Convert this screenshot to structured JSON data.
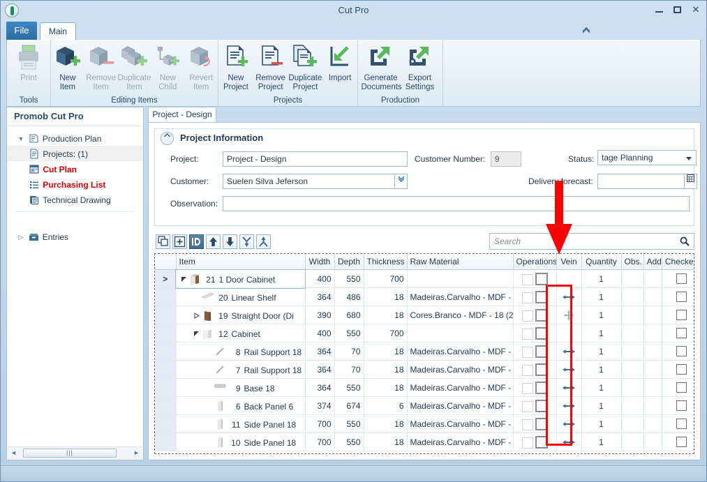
{
  "window": {
    "title": "Cut Pro",
    "minimize": "minimize-icon",
    "maximize": "maximize-icon",
    "close": "✕"
  },
  "ribbon": {
    "tabs": [
      {
        "label": "File",
        "id": "file"
      },
      {
        "label": "Main",
        "id": "main"
      }
    ],
    "groups": [
      {
        "label": "Tools",
        "items": [
          {
            "label_line1": "Print",
            "label_line2": "",
            "icon": "printer-icon",
            "enabled": false
          }
        ]
      },
      {
        "label": "Editing Items",
        "items": [
          {
            "label_line1": "New",
            "label_line2": "Item",
            "icon": "new-item-icon",
            "enabled": true
          },
          {
            "label_line1": "Remove",
            "label_line2": "Item",
            "icon": "remove-item-icon",
            "enabled": false
          },
          {
            "label_line1": "Duplicate",
            "label_line2": "Item",
            "icon": "duplicate-item-icon",
            "enabled": false
          },
          {
            "label_line1": "New",
            "label_line2": "Child",
            "icon": "new-child-icon",
            "enabled": false
          },
          {
            "label_line1": "Revert",
            "label_line2": "Item",
            "icon": "revert-item-icon",
            "enabled": false
          }
        ]
      },
      {
        "label": "Projects",
        "items": [
          {
            "label_line1": "New",
            "label_line2": "Project",
            "icon": "new-project-icon",
            "enabled": true
          },
          {
            "label_line1": "Remove",
            "label_line2": "Project",
            "icon": "remove-project-icon",
            "enabled": true
          },
          {
            "label_line1": "Duplicate",
            "label_line2": "Project",
            "icon": "duplicate-project-icon",
            "enabled": true
          },
          {
            "label_line1": "Import",
            "label_line2": "",
            "icon": "import-icon",
            "enabled": true
          }
        ]
      },
      {
        "label": "Production",
        "items": [
          {
            "label_line1": "Generate",
            "label_line2": "Documents",
            "icon": "generate-documents-icon",
            "enabled": true
          },
          {
            "label_line1": "Export",
            "label_line2": "Settings",
            "icon": "export-settings-icon",
            "enabled": true
          }
        ]
      }
    ],
    "collapse_icon": "chevron-up-icon"
  },
  "sidebar": {
    "title": "Promob Cut Pro",
    "items": [
      {
        "label": "Production Plan",
        "icon": "production-plan-icon",
        "level": 0,
        "expanded": true,
        "selected": false,
        "highlight": false
      },
      {
        "label": "Projects: (1)",
        "icon": "projects-icon",
        "level": 1,
        "expanded": null,
        "selected": true,
        "highlight": false
      },
      {
        "label": "Cut Plan",
        "icon": "cut-plan-icon",
        "level": 1,
        "expanded": null,
        "selected": false,
        "highlight": true
      },
      {
        "label": "Purchasing List",
        "icon": "purchasing-list-icon",
        "level": 1,
        "expanded": null,
        "selected": false,
        "highlight": true
      },
      {
        "label": "Technical Drawing",
        "icon": "technical-drawing-icon",
        "level": 1,
        "expanded": null,
        "selected": false,
        "highlight": false
      },
      {
        "label": "Entries",
        "icon": "entries-icon",
        "level": 0,
        "expanded": false,
        "selected": false,
        "highlight": false
      }
    ],
    "scrollbar": {
      "left_arrow": "◄",
      "right_arrow": "►",
      "grip": "|||"
    }
  },
  "document_tab": {
    "label": "Project - Design"
  },
  "project_information": {
    "header": "Project Information",
    "collapse_icon": "chevron-up-icon",
    "fields": {
      "project_label": "Project:",
      "project_value": "Project - Design",
      "customer_label": "Customer:",
      "customer_value": "Suelen Silva Jeferson",
      "observation_label": "Observation:",
      "observation_value": "",
      "customer_number_label": "Customer Number:",
      "customer_number_value": "9",
      "status_label": "Status:",
      "status_value": "tage Planning",
      "delivery_forecast_label": "Delivery forecast:",
      "delivery_forecast_value": ""
    }
  },
  "grid_toolbar": {
    "buttons": [
      {
        "name": "expand-all-button",
        "icon": "expand-all-icon",
        "active": false
      },
      {
        "name": "add-row-button",
        "icon": "plus-box-icon",
        "active": false
      },
      {
        "name": "id-toggle-button",
        "icon": "id-icon",
        "active": true
      },
      {
        "name": "move-up-button",
        "icon": "arrow-up-icon",
        "active": false
      },
      {
        "name": "move-down-button",
        "icon": "arrow-down-icon",
        "active": false
      },
      {
        "name": "collapse-branch-button",
        "icon": "merge-down-icon",
        "active": false
      },
      {
        "name": "expand-branch-button",
        "icon": "split-up-icon",
        "active": false
      }
    ]
  },
  "search": {
    "placeholder": "Search",
    "value": "",
    "icon": "search-icon"
  },
  "table": {
    "columns": [
      {
        "key": "rowsel",
        "label": ""
      },
      {
        "key": "item",
        "label": "Item"
      },
      {
        "key": "width",
        "label": "Width"
      },
      {
        "key": "depth",
        "label": "Depth"
      },
      {
        "key": "thickness",
        "label": "Thickness"
      },
      {
        "key": "raw_material",
        "label": "Raw Material"
      },
      {
        "key": "operations",
        "label": "Operations"
      },
      {
        "key": "vein",
        "label": "Vein"
      },
      {
        "key": "quantity",
        "label": "Quantity"
      },
      {
        "key": "obs",
        "label": "Obs."
      },
      {
        "key": "add",
        "label": "Add"
      },
      {
        "key": "checked",
        "label": "Checked"
      }
    ],
    "rows": [
      {
        "selected": true,
        "indent": 0,
        "twisty": "expanded",
        "icon": "cabinet-brown-icon",
        "num": "21",
        "name": "1 Door Cabinet",
        "width": "400",
        "depth": "550",
        "thickness": "700",
        "raw_material": "",
        "vein": "none",
        "quantity": "1",
        "checked": false
      },
      {
        "selected": false,
        "indent": 1,
        "twisty": "none",
        "icon": "shelf-icon",
        "num": "20",
        "name": "Linear Shelf",
        "width": "364",
        "depth": "486",
        "thickness": "18",
        "raw_material": "Madeiras.Carvalho - MDF - ",
        "vein": "horizontal",
        "quantity": "1",
        "checked": false
      },
      {
        "selected": false,
        "indent": 1,
        "twisty": "collapsed",
        "icon": "door-brown-icon",
        "num": "19",
        "name": "Straight Door (Di",
        "width": "390",
        "depth": "680",
        "thickness": "18",
        "raw_material": "Cores.Branco - MDF - 18 (2",
        "vein": "both",
        "quantity": "1",
        "checked": false
      },
      {
        "selected": false,
        "indent": 1,
        "twisty": "expanded",
        "icon": "cabinet-white-icon",
        "num": "12",
        "name": "Cabinet",
        "width": "400",
        "depth": "550",
        "thickness": "700",
        "raw_material": "",
        "vein": "none",
        "quantity": "1",
        "checked": false
      },
      {
        "selected": false,
        "indent": 2,
        "twisty": "none",
        "icon": "rail-icon",
        "num": "8",
        "name": "Rail Support 18",
        "width": "364",
        "depth": "70",
        "thickness": "18",
        "raw_material": "Madeiras.Carvalho - MDF - ",
        "vein": "horizontal",
        "quantity": "1",
        "checked": false
      },
      {
        "selected": false,
        "indent": 2,
        "twisty": "none",
        "icon": "rail-icon",
        "num": "7",
        "name": "Rail Support 18",
        "width": "364",
        "depth": "70",
        "thickness": "18",
        "raw_material": "Madeiras.Carvalho - MDF - ",
        "vein": "horizontal",
        "quantity": "1",
        "checked": false
      },
      {
        "selected": false,
        "indent": 2,
        "twisty": "none",
        "icon": "base-icon",
        "num": "9",
        "name": "Base 18",
        "width": "364",
        "depth": "550",
        "thickness": "18",
        "raw_material": "Madeiras.Carvalho - MDF - ",
        "vein": "horizontal",
        "quantity": "1",
        "checked": false
      },
      {
        "selected": false,
        "indent": 2,
        "twisty": "none",
        "icon": "panel-icon",
        "num": "6",
        "name": "Back Panel 6",
        "width": "374",
        "depth": "674",
        "thickness": "6",
        "raw_material": "Madeiras.Carvalho - MDF - ",
        "vein": "horizontal",
        "quantity": "1",
        "checked": false
      },
      {
        "selected": false,
        "indent": 2,
        "twisty": "none",
        "icon": "panel-icon",
        "num": "11",
        "name": "Side Panel 18",
        "width": "700",
        "depth": "550",
        "thickness": "18",
        "raw_material": "Madeiras.Carvalho - MDF - ",
        "vein": "horizontal",
        "quantity": "1",
        "checked": false
      },
      {
        "selected": false,
        "indent": 2,
        "twisty": "none",
        "icon": "panel-icon",
        "num": "10",
        "name": "Side Panel 18",
        "width": "700",
        "depth": "550",
        "thickness": "18",
        "raw_material": "Madeiras.Carvalho - MDF - ",
        "vein": "horizontal",
        "quantity": "1",
        "checked": false
      }
    ]
  },
  "annotations": {
    "arrow": {
      "name": "red-down-arrow",
      "color": "#ff0000",
      "points_to": "Vein"
    },
    "rect": {
      "name": "red-highlight-rect",
      "color": "#ff0000",
      "surrounds": "Vein column cells"
    }
  }
}
